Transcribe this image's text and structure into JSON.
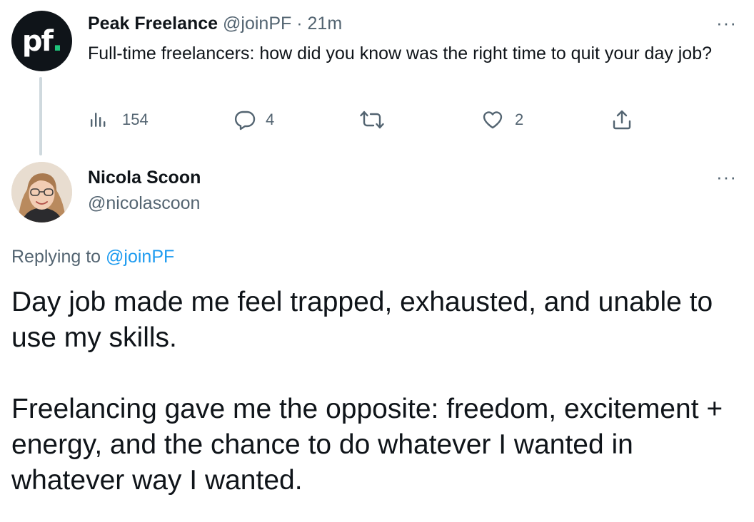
{
  "parent_tweet": {
    "avatar_text": "pf",
    "avatar_dot": ".",
    "name": "Peak Freelance",
    "handle": "@joinPF",
    "separator": "·",
    "time": "21m",
    "text": "Full-time freelancers: how did you know was the right time to quit your day job?",
    "more_label": "···",
    "actions": {
      "views": "154",
      "replies": "4",
      "retweets": "",
      "likes": "2"
    }
  },
  "reply": {
    "name": "Nicola Scoon",
    "handle": "@nicolascoon",
    "more_label": "···",
    "replying_prefix": "Replying to",
    "replying_to": "@joinPF",
    "paragraphs": [
      "Day job made me feel trapped, exhausted, and unable to use my skills.",
      "Freelancing gave me the opposite: freedom, excitement + energy, and the chance to do whatever I wanted in whatever way I wanted."
    ]
  },
  "colors": {
    "text": "#0f1419",
    "secondary": "#536471",
    "link": "#1d9bf0",
    "thread_line": "#cfd9de",
    "pf_dot": "#1fc47b"
  }
}
